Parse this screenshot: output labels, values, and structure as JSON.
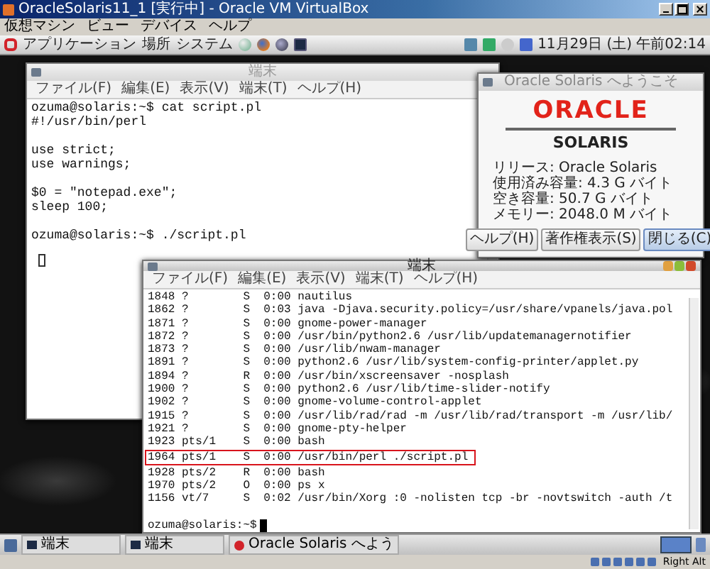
{
  "vbox_window": {
    "title": "OracleSolaris11_1 [実行中] - Oracle VM VirtualBox"
  },
  "vbox_menu": [
    "仮想マシン",
    "ビュー",
    "デバイス",
    "ヘルプ"
  ],
  "top_panel": {
    "menus": [
      "アプリケーション",
      "場所",
      "システム"
    ],
    "clock": "11月29日 (土) 午前02:14"
  },
  "terminal_back": {
    "title": "端末",
    "active": false,
    "menu": [
      "ファイル(F)",
      "編集(E)",
      "表示(V)",
      "端末(T)",
      "ヘルプ(H)"
    ],
    "blocks": [
      [
        "ozuma@solaris:~$ cat script.pl",
        "#!/usr/bin/perl"
      ],
      [
        "use strict;",
        "use warnings;"
      ],
      [
        "$0 = \"notepad.exe\";",
        "sleep 100;"
      ],
      [
        "ozuma@solaris:~$ ./script.pl"
      ]
    ]
  },
  "about_dialog": {
    "title": "Oracle Solaris へようこそ",
    "logo": "ORACLE",
    "product": "SOLARIS",
    "info": [
      "リリース: Oracle Solaris",
      "使用済み容量: 4.3 G バイト",
      "空き容量: 50.7 G バイト",
      "メモリー: 2048.0 M バイト"
    ],
    "buttons": [
      {
        "label": "ヘルプ(H)",
        "focused": false
      },
      {
        "label": "著作権表示(S)",
        "focused": false
      },
      {
        "label": "閉じる(C)",
        "focused": true
      }
    ]
  },
  "terminal_front": {
    "title": "端末",
    "active": true,
    "menu": [
      "ファイル(F)",
      "編集(E)",
      "表示(V)",
      "端末(T)",
      "ヘルプ(H)"
    ],
    "lines": [
      {
        "text": "1848 ?        S  0:00 nautilus",
        "highlighted": false
      },
      {
        "text": "1862 ?        S  0:03 java -Djava.security.policy=/usr/share/vpanels/java.pol",
        "highlighted": false
      },
      {
        "text": "1871 ?        S  0:00 gnome-power-manager",
        "highlighted": false
      },
      {
        "text": "1872 ?        S  0:00 /usr/bin/python2.6 /usr/lib/updatemanagernotifier",
        "highlighted": false
      },
      {
        "text": "1873 ?        S  0:00 /usr/lib/nwam-manager",
        "highlighted": false
      },
      {
        "text": "1891 ?        S  0:00 python2.6 /usr/lib/system-config-printer/applet.py",
        "highlighted": false
      },
      {
        "text": "1894 ?        R  0:00 /usr/bin/xscreensaver -nosplash",
        "highlighted": false
      },
      {
        "text": "1900 ?        S  0:00 python2.6 /usr/lib/time-slider-notify",
        "highlighted": false
      },
      {
        "text": "1902 ?        S  0:00 gnome-volume-control-applet",
        "highlighted": false
      },
      {
        "text": "1915 ?        S  0:00 /usr/lib/rad/rad -m /usr/lib/rad/transport -m /usr/lib/",
        "highlighted": false
      },
      {
        "text": "1921 ?        S  0:00 gnome-pty-helper",
        "highlighted": false
      },
      {
        "text": "1923 pts/1    S  0:00 bash",
        "highlighted": false
      },
      {
        "text": "1964 pts/1    S  0:00 /usr/bin/perl ./script.pl",
        "highlighted": true
      },
      {
        "text": "1928 pts/2    R  0:00 bash",
        "highlighted": false
      },
      {
        "text": "1970 pts/2    O  0:00 ps x",
        "highlighted": false
      },
      {
        "text": "1156 vt/7     S  0:02 /usr/bin/Xorg :0 -nolisten tcp -br -novtswitch -auth /t",
        "highlighted": false
      }
    ],
    "prompt": "ozuma@solaris:~$"
  },
  "taskbar": [
    {
      "kind": "terminal",
      "label": "端末"
    },
    {
      "kind": "terminal",
      "label": "端末"
    },
    {
      "kind": "welcome",
      "label": "Oracle Solaris へよう"
    }
  ],
  "status_bar": {
    "host_key": "Right Alt"
  }
}
